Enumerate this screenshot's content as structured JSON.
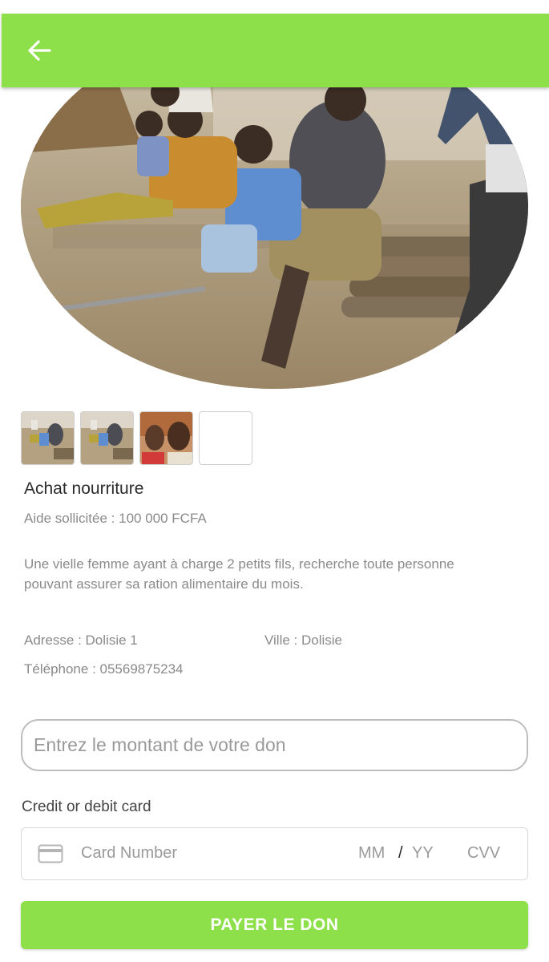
{
  "header": {
    "back_icon": "arrow-left-icon",
    "bar_color": "#8ee04b"
  },
  "gallery": {
    "main_image": "photo of children sitting with an adult on wooden logs outdoors",
    "thumbnails": [
      {
        "image": "photo of children and adult on logs"
      },
      {
        "image": "photo of children and adult on logs"
      },
      {
        "image": "portrait photo of two young children"
      },
      {
        "image": "empty thumbnail slot"
      }
    ]
  },
  "request": {
    "title": "Achat nourriture",
    "amount_requested": "Aide sollicitée : 100 000 FCFA",
    "description": "Une vielle femme ayant à charge 2 petits fils, recherche toute personne pouvant assurer sa ration alimentaire du mois.",
    "address": "Adresse : Dolisie 1",
    "city": "Ville : Dolisie",
    "phone": "Téléphone : 05569875234"
  },
  "donation": {
    "amount_placeholder": "Entrez le montant de votre don",
    "amount_value": ""
  },
  "card": {
    "section_label": "Credit or debit card",
    "card_icon": "credit-card-icon",
    "number_placeholder": "Card Number",
    "month_placeholder": "MM",
    "separator": "/",
    "year_placeholder": "YY",
    "cvv_placeholder": "CVV"
  },
  "actions": {
    "pay_label": "PAYER LE DON",
    "accent_color": "#8ee04b"
  }
}
